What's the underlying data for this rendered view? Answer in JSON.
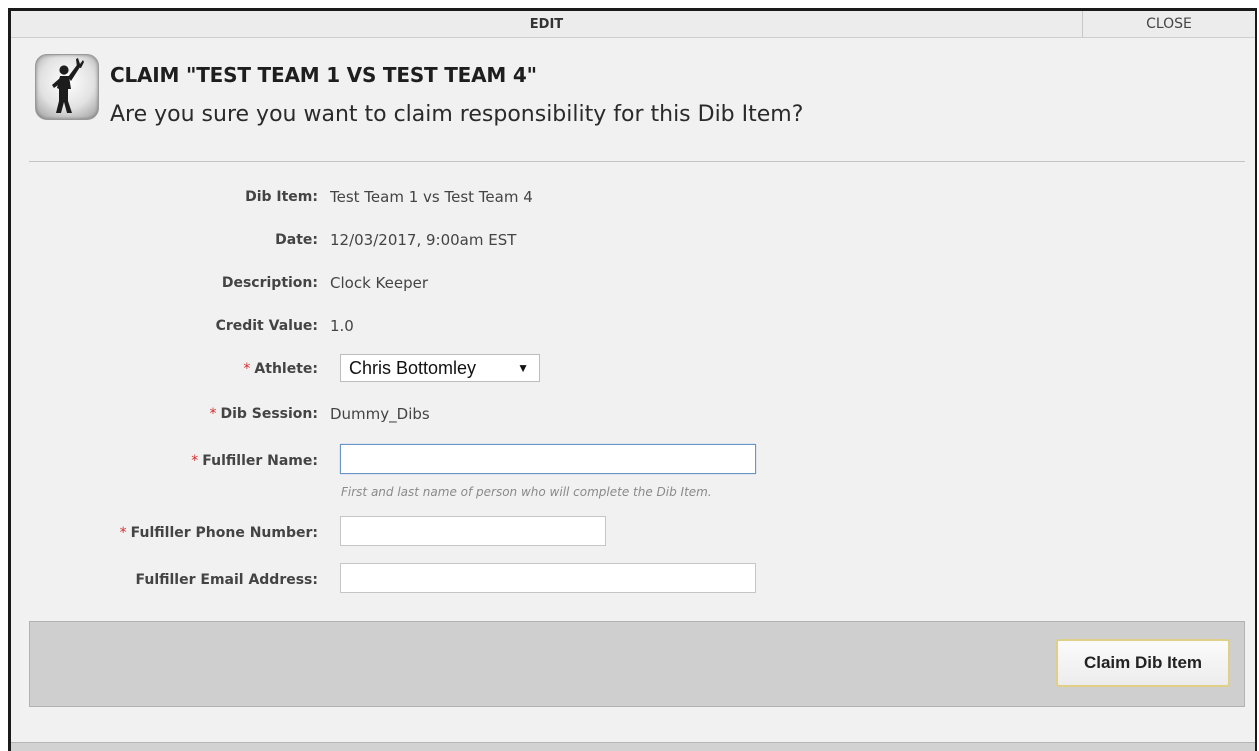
{
  "topbar": {
    "edit_label": "EDIT",
    "close_label": "CLOSE"
  },
  "header": {
    "icon": "volunteer-waving-figure-icon",
    "title": "CLAIM \"TEST TEAM 1 VS TEST TEAM 4\"",
    "subtitle": "Are you sure you want to claim responsibility for this Dib Item?"
  },
  "form": {
    "required_marker": "*",
    "dib_item": {
      "label": "Dib Item:",
      "value": "Test Team 1 vs Test Team 4"
    },
    "date": {
      "label": "Date:",
      "value": "12/03/2017, 9:00am EST"
    },
    "description": {
      "label": "Description:",
      "value": "Clock Keeper"
    },
    "credit_value": {
      "label": "Credit Value:",
      "value": "1.0"
    },
    "athlete": {
      "label": "Athlete:",
      "selected": "Chris Bottomley",
      "caret": "▼"
    },
    "dib_session": {
      "label": "Dib Session:",
      "value": "Dummy_Dibs"
    },
    "fulfiller_name": {
      "label": "Fulfiller Name:",
      "value": "",
      "hint": "First and last name of person who will complete the Dib Item."
    },
    "fulfiller_phone": {
      "label": "Fulfiller Phone Number:",
      "value": ""
    },
    "fulfiller_email": {
      "label": "Fulfiller Email Address:",
      "value": ""
    }
  },
  "footer": {
    "claim_label": "Claim Dib Item",
    "claim_button_border": "#e0cf86"
  },
  "colors": {
    "required": "#d52b2b",
    "focus_border": "#6a95c9"
  }
}
